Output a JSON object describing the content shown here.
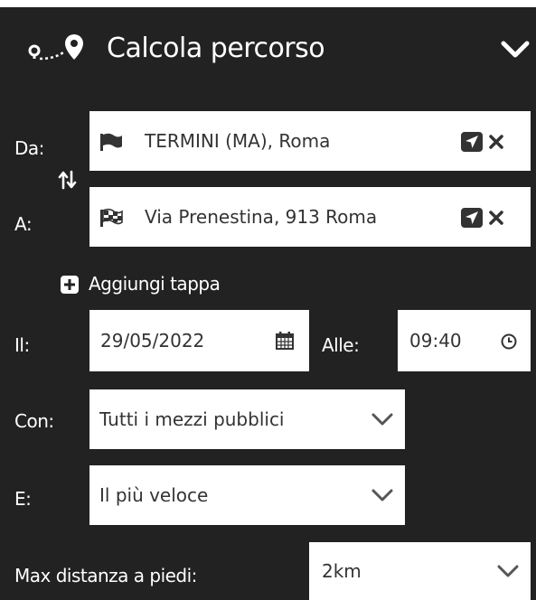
{
  "header": {
    "title": "Calcola percorso"
  },
  "route": {
    "from_label": "Da:",
    "from_value": "TERMINI (MA), Roma",
    "to_label": "A:",
    "to_value": "Via Prenestina, 913 Roma",
    "add_stop_label": "Aggiungi tappa"
  },
  "when": {
    "date_label": "Il:",
    "date_value": "29/05/2022",
    "time_label": "Alle:",
    "time_value": "09:40"
  },
  "options": {
    "mode_label": "Con:",
    "mode_value": "Tutti i mezzi pubblici",
    "criteria_label": "E:",
    "criteria_value": "Il più veloce",
    "walk_label": "Max distanza a piedi:",
    "walk_value": "2km"
  },
  "colors": {
    "panel_bg": "#222222",
    "field_bg": "#ffffff",
    "text_dark": "#333333"
  }
}
